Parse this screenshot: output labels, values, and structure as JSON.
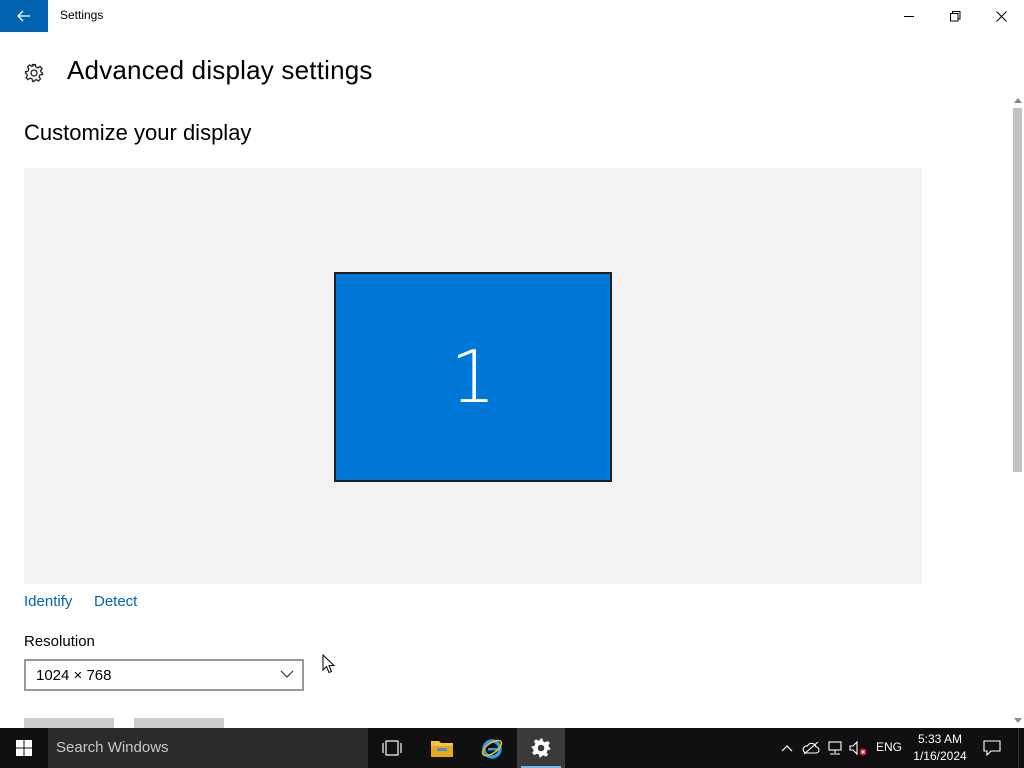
{
  "window": {
    "title": "Settings"
  },
  "header": {
    "title": "Advanced display settings",
    "icon": "gear-icon"
  },
  "section": {
    "title": "Customize your display"
  },
  "display": {
    "monitor_number": "1"
  },
  "links": {
    "identify": "Identify",
    "detect": "Detect"
  },
  "resolution": {
    "label": "Resolution",
    "value": "1024 × 768"
  },
  "taskbar": {
    "search_placeholder": "Search Windows",
    "language": "ENG",
    "time": "5:33 AM",
    "date": "1/16/2024"
  },
  "colors": {
    "accent": "#0063b1",
    "monitor": "#0078d7",
    "taskbar": "#101010"
  }
}
